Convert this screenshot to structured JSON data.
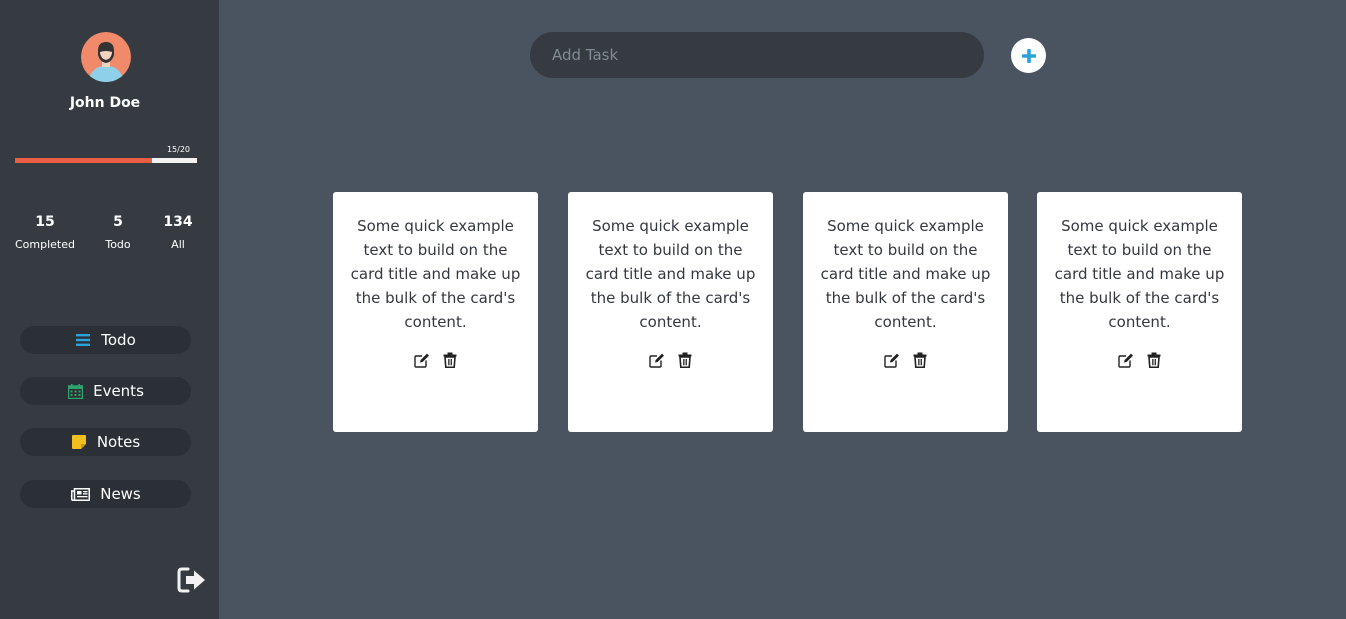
{
  "user": {
    "name": "John Doe"
  },
  "progress": {
    "label": "15/20",
    "fraction": 0.75
  },
  "stats": [
    {
      "value": "15",
      "label": "Completed"
    },
    {
      "value": "5",
      "label": "Todo"
    },
    {
      "value": "134",
      "label": "All"
    }
  ],
  "nav": [
    {
      "label": "Todo",
      "icon": "list-icon",
      "color": "#2aa3d8"
    },
    {
      "label": "Events",
      "icon": "calendar-icon",
      "color": "#2ea36b"
    },
    {
      "label": "Notes",
      "icon": "note-icon",
      "color": "#f2c01e"
    },
    {
      "label": "News",
      "icon": "newspaper-icon",
      "color": "#ffffff"
    }
  ],
  "task_input": {
    "placeholder": "Add Task"
  },
  "add_button_color": "#2aa3d8",
  "cards": [
    {
      "text": "Some quick example text to build on the card title and make up the bulk of the card's content."
    },
    {
      "text": "Some quick example text to build on the card title and make up the bulk of the card's content."
    },
    {
      "text": "Some quick example text to build on the card title and make up the bulk of the card's content."
    },
    {
      "text": "Some quick example text to build on the card title and make up the bulk of the card's content."
    }
  ]
}
